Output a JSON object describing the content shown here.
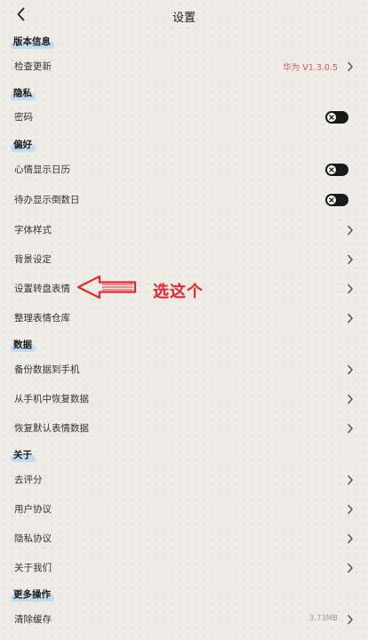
{
  "header": {
    "title": "设置",
    "back_icon": "chevron-left-icon"
  },
  "sections": {
    "version": "版本信息",
    "privacy": "隐私",
    "preferences": "偏好",
    "data": "数据",
    "about": "关于",
    "more": "更多操作"
  },
  "items": {
    "check_update": {
      "label": "检查更新",
      "value": "华为 V1.3.0.5"
    },
    "password": {
      "label": "密码",
      "toggle": "off"
    },
    "mood_calendar": {
      "label": "心情显示日历",
      "toggle": "off"
    },
    "todo_countdown": {
      "label": "待办显示倒数日",
      "toggle": "off"
    },
    "font_style": {
      "label": "字体样式"
    },
    "background": {
      "label": "背景设定"
    },
    "wheel_emoji": {
      "label": "设置转盘表情"
    },
    "emoji_store": {
      "label": "整理表情仓库"
    },
    "backup": {
      "label": "备份数据到手机"
    },
    "restore": {
      "label": "从手机中恢复数据"
    },
    "reset_emoji": {
      "label": "恢复默认表情数据"
    },
    "rate": {
      "label": "去评分"
    },
    "user_agreement": {
      "label": "用户协议"
    },
    "privacy_policy": {
      "label": "隐私协议"
    },
    "about_us": {
      "label": "关于我们"
    },
    "clear_cache": {
      "label": "清除缓存",
      "value": "3.73MB"
    }
  },
  "annotation": {
    "text": "选这个",
    "color": "#e8262b"
  },
  "colors": {
    "section_highlight": "#c3dcf0",
    "version_value": "#d95b5b",
    "toggle_off": "#1a1a1a"
  }
}
